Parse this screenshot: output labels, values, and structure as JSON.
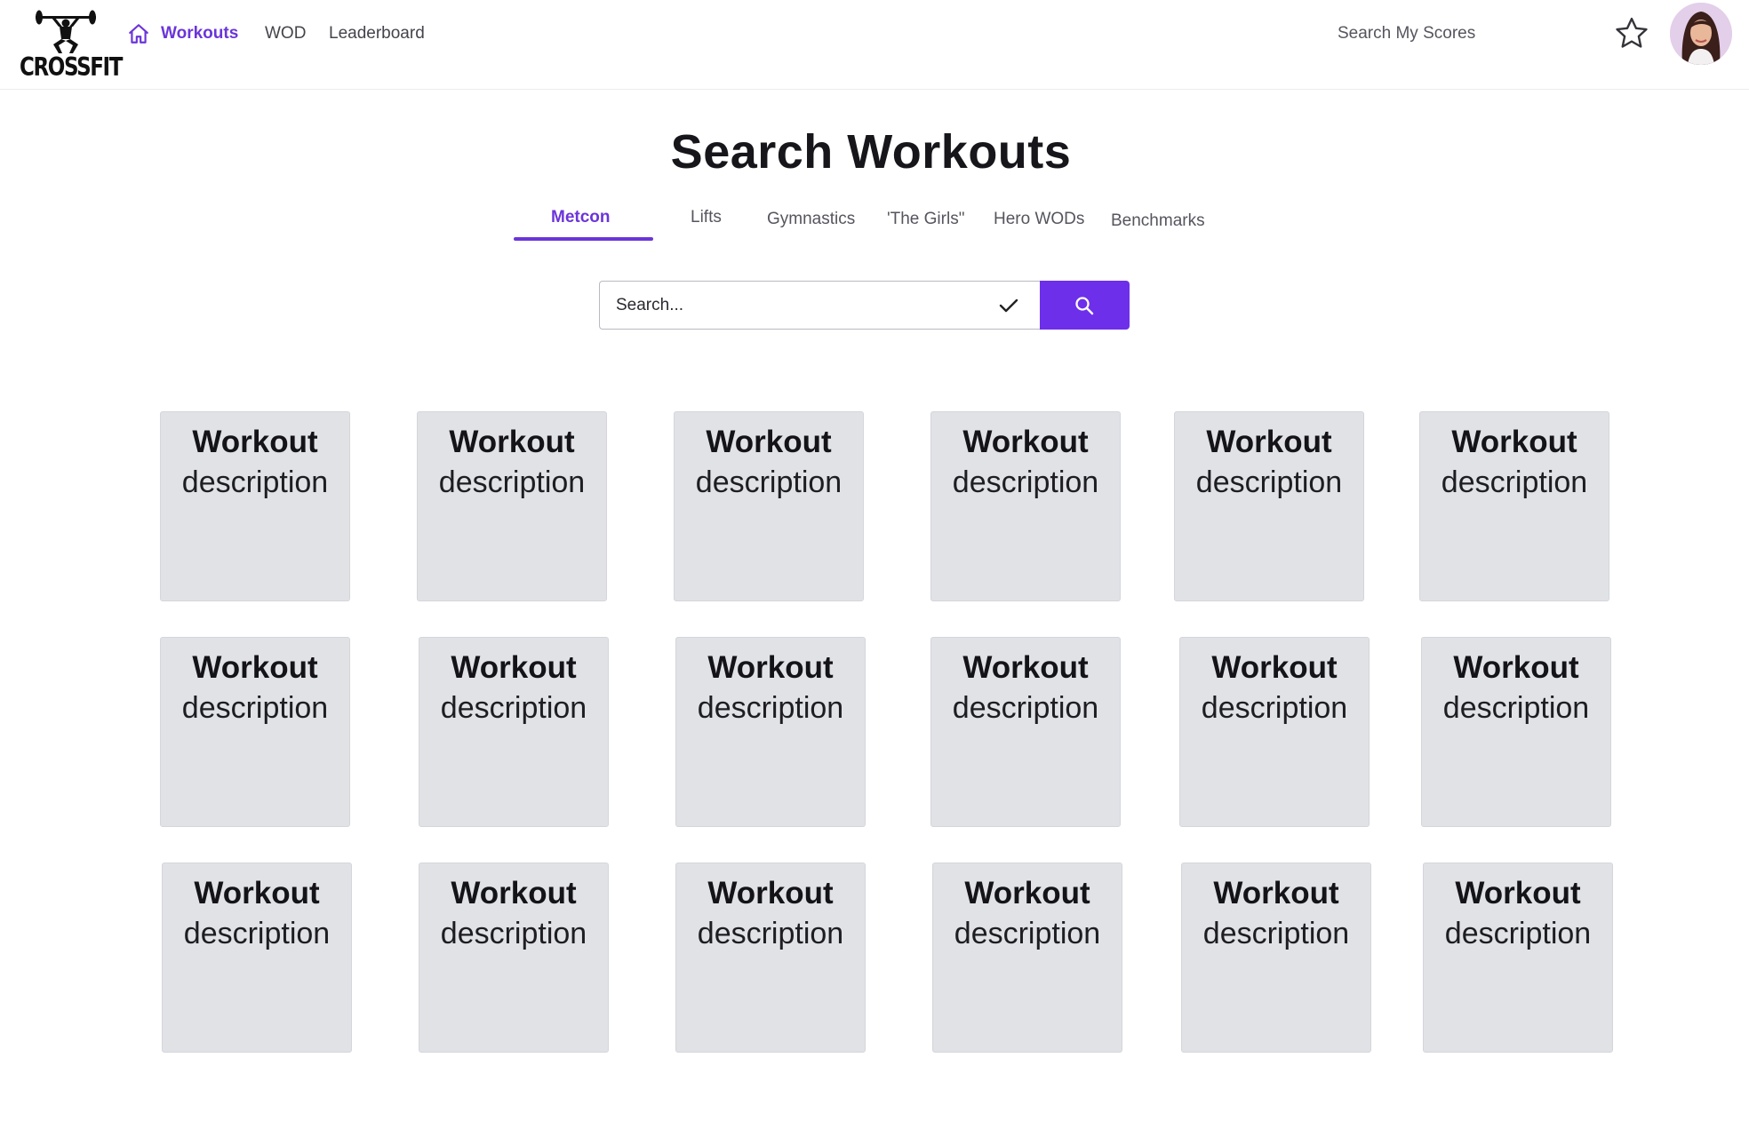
{
  "brand": {
    "name": "CROSSFIT"
  },
  "nav": {
    "items": [
      {
        "label": "Workouts",
        "active": true,
        "icon": "home-icon"
      },
      {
        "label": "WOD"
      },
      {
        "label": "Leaderboard"
      }
    ],
    "search_scores": "Search My Scores",
    "favorites_icon": "star-icon"
  },
  "page": {
    "title": "Search Workouts"
  },
  "tabs": [
    {
      "label": "Metcon",
      "active": true
    },
    {
      "label": "Lifts"
    },
    {
      "label": "Gymnastics"
    },
    {
      "label": "'The Girls\""
    },
    {
      "label": "Hero WODs"
    },
    {
      "label": "Benchmarks"
    }
  ],
  "search": {
    "placeholder": "Search...",
    "confirm_icon": "check-icon",
    "button_icon": "search-icon"
  },
  "colors": {
    "accent": "#6d2fea",
    "card_bg": "#e0e2e6"
  },
  "cards": [
    {
      "title": "Workout",
      "desc": "description"
    },
    {
      "title": "Workout",
      "desc": "description"
    },
    {
      "title": "Workout",
      "desc": "description"
    },
    {
      "title": "Workout",
      "desc": "description"
    },
    {
      "title": "Workout",
      "desc": "description"
    },
    {
      "title": "Workout",
      "desc": "description"
    },
    {
      "title": "Workout",
      "desc": "description"
    },
    {
      "title": "Workout",
      "desc": "description"
    },
    {
      "title": "Workout",
      "desc": "description"
    },
    {
      "title": "Workout",
      "desc": "description"
    },
    {
      "title": "Workout",
      "desc": "description"
    },
    {
      "title": "Workout",
      "desc": "description"
    },
    {
      "title": "Workout",
      "desc": "description"
    },
    {
      "title": "Workout",
      "desc": "description"
    },
    {
      "title": "Workout",
      "desc": "description"
    },
    {
      "title": "Workout",
      "desc": "description"
    },
    {
      "title": "Workout",
      "desc": "description"
    },
    {
      "title": "Workout",
      "desc": "description"
    }
  ]
}
